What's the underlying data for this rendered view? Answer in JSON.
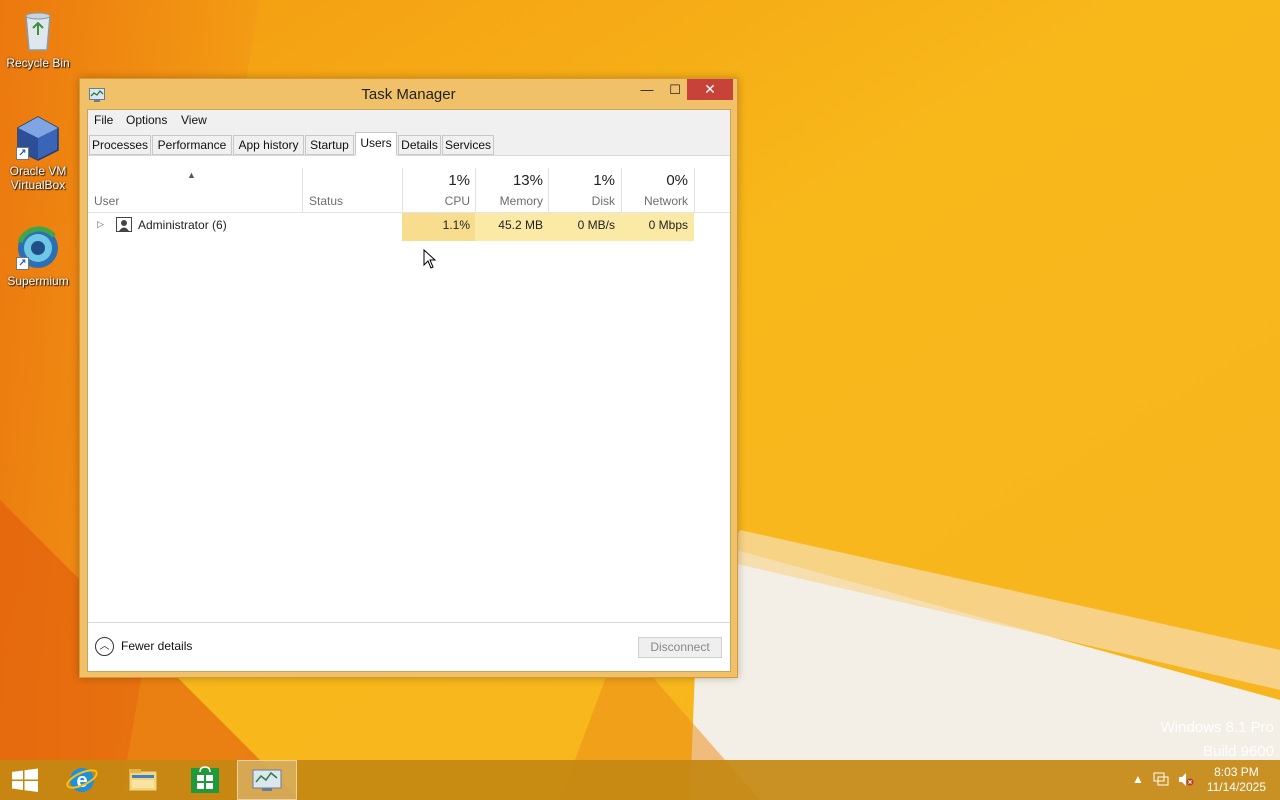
{
  "desktop": {
    "icons": [
      {
        "label_line1": "Recycle Bin",
        "label_line2": "",
        "icon": "recycle-bin-icon"
      },
      {
        "label_line1": "Oracle VM",
        "label_line2": "VirtualBox",
        "icon": "virtualbox-icon"
      },
      {
        "label_line1": "Supermium",
        "label_line2": "",
        "icon": "supermium-icon"
      }
    ],
    "watermark": {
      "line1": "Windows 8.1 Pro",
      "line2": "Build 9600"
    }
  },
  "window": {
    "title": "Task Manager",
    "caption_buttons": {
      "minimize": "—",
      "maximize": "☐",
      "close": "✕"
    },
    "menu": [
      "File",
      "Options",
      "View"
    ],
    "tabs": [
      "Processes",
      "Performance",
      "App history",
      "Startup",
      "Users",
      "Details",
      "Services"
    ],
    "active_tab": "Users",
    "columns": {
      "user": "User",
      "status": "Status",
      "cpu": {
        "percent": "1%",
        "label": "CPU"
      },
      "memory": {
        "percent": "13%",
        "label": "Memory"
      },
      "disk": {
        "percent": "1%",
        "label": "Disk"
      },
      "network": {
        "percent": "0%",
        "label": "Network"
      }
    },
    "rows": [
      {
        "user": "Administrator (6)",
        "status": "",
        "cpu": "1.1%",
        "memory": "45.2 MB",
        "disk": "0 MB/s",
        "network": "0 Mbps"
      }
    ],
    "footer": {
      "fewer_details": "Fewer details",
      "disconnect": "Disconnect"
    }
  },
  "taskbar": {
    "buttons": [
      "start-button",
      "internet-explorer-icon",
      "file-explorer-icon",
      "store-icon",
      "task-manager-icon"
    ],
    "clock": {
      "time": "8:03 PM",
      "date": "11/14/2025"
    }
  },
  "colors": {
    "wallpaper": "#f6b21a",
    "heat_cell": "#fbe9a6",
    "close_button": "#c7433a",
    "window_frame": "#f1c16a"
  }
}
